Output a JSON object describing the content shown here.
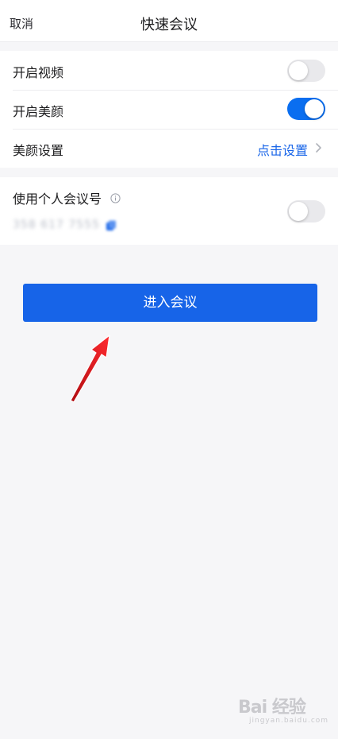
{
  "header": {
    "cancel_label": "取消",
    "title": "快速会议"
  },
  "settings": {
    "video": {
      "label": "开启视频",
      "enabled": false
    },
    "beauty": {
      "label": "开启美颜",
      "enabled": true
    },
    "beauty_settings": {
      "label": "美颜设置",
      "action_label": "点击设置"
    }
  },
  "personal_meeting": {
    "label": "使用个人会议号",
    "meeting_number": "358 617 7555",
    "enabled": false
  },
  "enter_button": {
    "label": "进入会议"
  },
  "watermark": {
    "logo": "Bai 经验",
    "sub": "jingyan.baidu.com"
  },
  "colors": {
    "accent": "#1764e8",
    "toggle_on": "#0a6ef0",
    "toggle_off": "#e9e9ec",
    "background": "#f6f6f8",
    "annotation_arrow": "#e8141b"
  }
}
